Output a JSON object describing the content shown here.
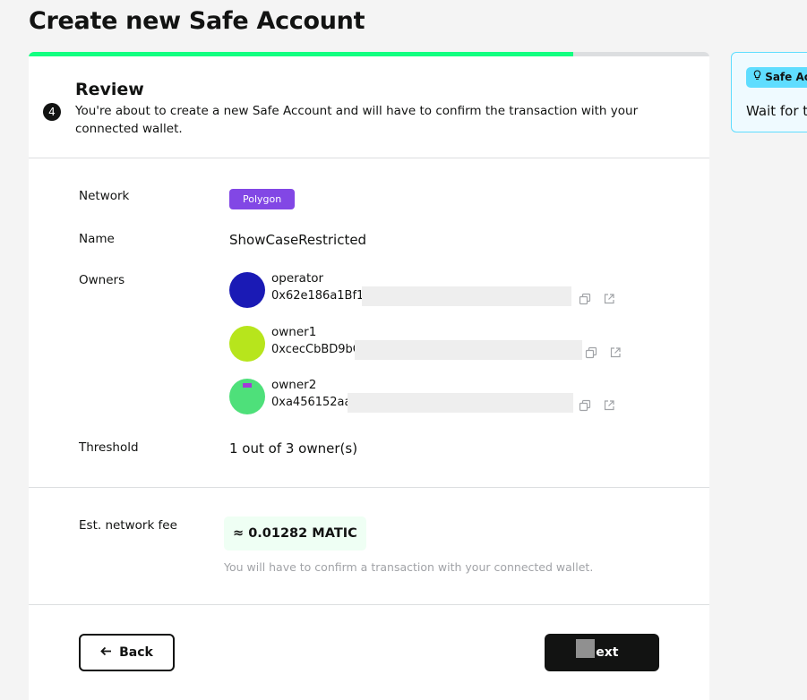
{
  "page": {
    "title": "Create new Safe Account"
  },
  "progress": {
    "fraction": 0.8
  },
  "step": {
    "number": "4",
    "title": "Review",
    "description": "You're about to create a new Safe Account and will have to confirm the transaction with your connected wallet."
  },
  "review": {
    "network_label": "Network",
    "network_value": "Polygon",
    "network_color": "#8247e5",
    "name_label": "Name",
    "name_value": "ShowCaseRestricted",
    "owners_label": "Owners",
    "owners": [
      {
        "name": "operator",
        "address": "0x62e186a1Bf110838"
      },
      {
        "name": "owner1",
        "address": "0xcecCbBD9bCa111A"
      },
      {
        "name": "owner2",
        "address": "0xa456152aaA6154b"
      }
    ],
    "threshold_label": "Threshold",
    "threshold_value": "1 out of 3 owner(s)"
  },
  "fee": {
    "label": "Est. network fee",
    "value": "≈ 0.01282 MATIC",
    "note": "You will have to confirm a transaction with your connected wallet."
  },
  "actions": {
    "back_label": "Back",
    "next_label": "Next"
  },
  "side_panel": {
    "badge": "Safe Ac",
    "text": "Wait for t"
  },
  "icons": {
    "copy": "copy-icon",
    "external_link": "external-link-icon",
    "back_arrow": "arrow-left-icon",
    "bulb": "lightbulb-icon"
  },
  "colors": {
    "progress": "#12ff80",
    "primary": "#121312",
    "fee_background": "#effff4",
    "info": "#5fddff"
  }
}
